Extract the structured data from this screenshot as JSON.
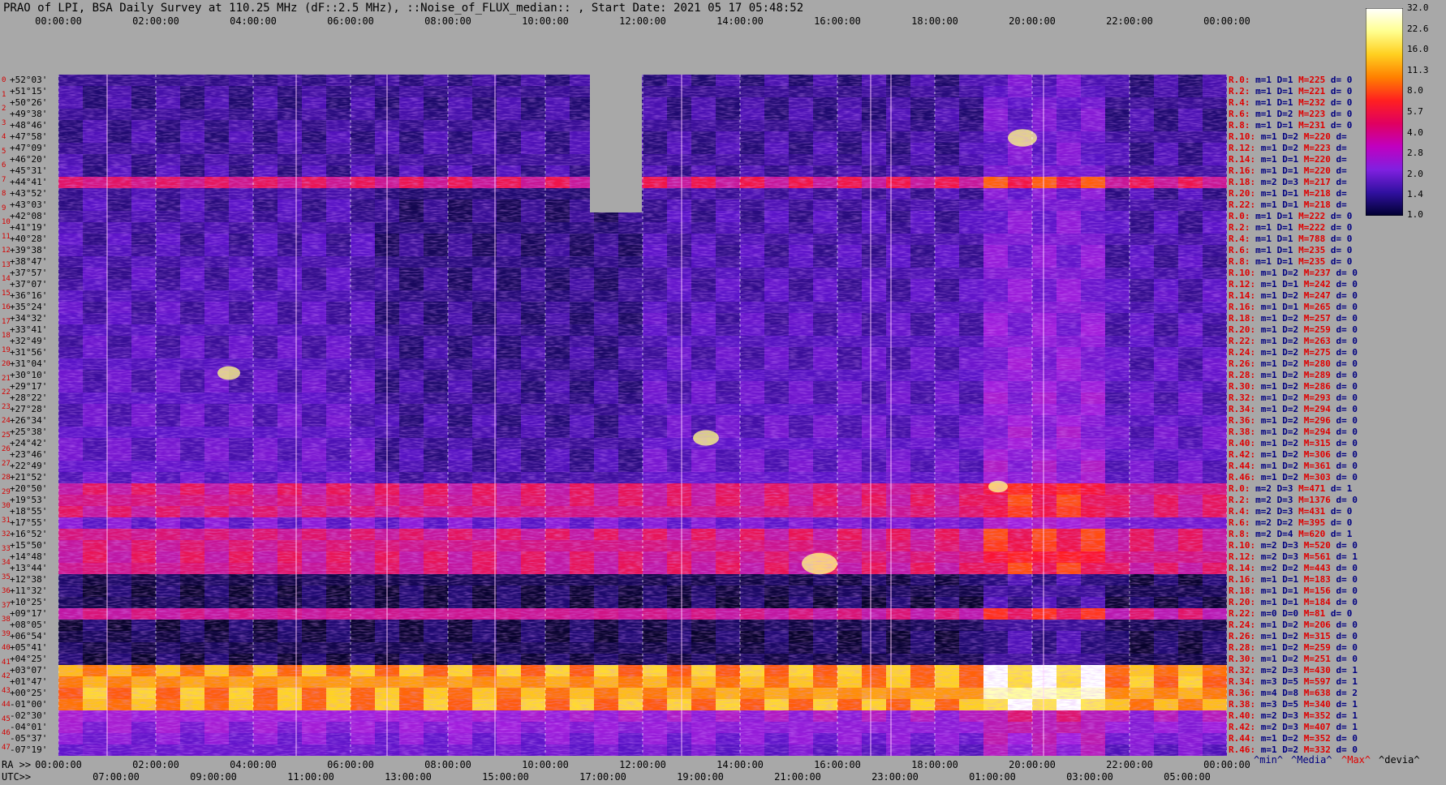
{
  "chart_data": {
    "type": "heatmap",
    "title": "PRAO of LPI, BSA Daily Survey at 110.25 MHz (dF::2.5 MHz), ::Noise_of_FLUX_median:: , Start Date: 2021 05 17 05:48:52",
    "x_top_ticks": [
      "00:00:00",
      "02:00:00",
      "04:00:00",
      "06:00:00",
      "08:00:00",
      "10:00:00",
      "12:00:00",
      "14:00:00",
      "16:00:00",
      "18:00:00",
      "20:00:00",
      "22:00:00",
      "00:00:00"
    ],
    "x_ra_ticks": [
      "00:00:00",
      "02:00:00",
      "04:00:00",
      "06:00:00",
      "08:00:00",
      "10:00:00",
      "12:00:00",
      "14:00:00",
      "16:00:00",
      "18:00:00",
      "20:00:00",
      "22:00:00",
      "00:00:00"
    ],
    "x_utc_ticks": [
      "07:00:00",
      "09:00:00",
      "11:00:00",
      "13:00:00",
      "15:00:00",
      "17:00:00",
      "19:00:00",
      "21:00:00",
      "23:00:00",
      "01:00:00",
      "03:00:00",
      "05:00:00"
    ],
    "ra_prefix": "RA >>",
    "utc_prefix": "UTC>>",
    "declinations": [
      "+52°03'",
      "+51°15'",
      "+50°26'",
      "+49°38'",
      "+48°46'",
      "+47°58'",
      "+47°09'",
      "+46°20'",
      "+45°31'",
      "+44°41'",
      "+43°52'",
      "+43°03'",
      "+42°08'",
      "+41°19'",
      "+40°28'",
      "+39°38'",
      "+38°47'",
      "+37°57'",
      "+37°07'",
      "+36°16'",
      "+35°24'",
      "+34°32'",
      "+33°41'",
      "+32°49'",
      "+31°56'",
      "+31°04'",
      "+30°10'",
      "+29°17'",
      "+28°22'",
      "+27°28'",
      "+26°34'",
      "+25°38'",
      "+24°42'",
      "+23°46'",
      "+22°49'",
      "+21°52'",
      "+20°50'",
      "+19°53'",
      "+18°55'",
      "+17°55'",
      "+16°52'",
      "+15°50'",
      "+14°48'",
      "+13°44'",
      "+12°38'",
      "+11°32'",
      "+10°25'",
      "+09°17'",
      "+08°05'",
      "+06°54'",
      "+05°41'",
      "+04°25'",
      "+03°07'",
      "+01°47'",
      "+00°25'",
      "-01°00'",
      "-02°30'",
      "-04°01'",
      "-05°37'",
      "-07°19'"
    ],
    "row_indices": [
      "0",
      "1",
      "2",
      "3",
      "4",
      "5",
      "6",
      "7",
      "8",
      "9",
      "10",
      "11",
      "12",
      "13",
      "14",
      "15",
      "16",
      "17",
      "18",
      "19",
      "20",
      "21",
      "22",
      "23",
      "24",
      "25",
      "26",
      "27",
      "28",
      "29",
      "30",
      "31",
      "32",
      "33",
      "34",
      "35",
      "36",
      "37",
      "38",
      "39",
      "40",
      "41",
      "42",
      "43",
      "44",
      "45",
      "46",
      "47"
    ],
    "colorbar": {
      "ticks": [
        "32.0",
        "22.6",
        "16.0",
        "11.3",
        "8.0",
        "5.7",
        "4.0",
        "2.8",
        "2.0",
        "1.4",
        "1.0"
      ],
      "colors": [
        "#ffffff",
        "#ffff90",
        "#ffd020",
        "#ff8000",
        "#ff2020",
        "#e00060",
        "#c000c0",
        "#8020e0",
        "#3010a0",
        "#000030"
      ]
    },
    "right_labels": [
      {
        "r": "R.0:",
        "m": "m=1",
        "D": "D=1",
        "M": "M=225",
        "d": "d= 0"
      },
      {
        "r": "R.2:",
        "m": "m=1",
        "D": "D=1",
        "M": "M=221",
        "d": "d= 0"
      },
      {
        "r": "R.4:",
        "m": "m=1",
        "D": "D=1",
        "M": "M=232",
        "d": "d= 0"
      },
      {
        "r": "R.6:",
        "m": "m=1",
        "D": "D=2",
        "M": "M=223",
        "d": "d= 0"
      },
      {
        "r": "R.8:",
        "m": "m=1",
        "D": "D=1",
        "M": "M=231",
        "d": "d= 0"
      },
      {
        "r": "R.10:",
        "m": "m=1",
        "D": "D=2",
        "M": "M=220",
        "d": "d="
      },
      {
        "r": "R.12:",
        "m": "m=1",
        "D": "D=2",
        "M": "M=223",
        "d": "d="
      },
      {
        "r": "R.14:",
        "m": "m=1",
        "D": "D=1",
        "M": "M=220",
        "d": "d="
      },
      {
        "r": "R.16:",
        "m": "m=1",
        "D": "D=1",
        "M": "M=220",
        "d": "d="
      },
      {
        "r": "R.18:",
        "m": "m=2",
        "D": "D=3",
        "M": "M=217",
        "d": "d="
      },
      {
        "r": "R.20:",
        "m": "m=1",
        "D": "D=1",
        "M": "M=218",
        "d": "d="
      },
      {
        "r": "R.22:",
        "m": "m=1",
        "D": "D=1",
        "M": "M=218",
        "d": "d="
      },
      {
        "r": "R.0:",
        "m": "m=1",
        "D": "D=1",
        "M": "M=222",
        "d": "d= 0"
      },
      {
        "r": "R.2:",
        "m": "m=1",
        "D": "D=1",
        "M": "M=222",
        "d": "d= 0"
      },
      {
        "r": "R.4:",
        "m": "m=1",
        "D": "D=1",
        "M": "M=788",
        "d": "d= 0"
      },
      {
        "r": "R.6:",
        "m": "m=1",
        "D": "D=1",
        "M": "M=235",
        "d": "d= 0"
      },
      {
        "r": "R.8:",
        "m": "m=1",
        "D": "D=1",
        "M": "M=235",
        "d": "d= 0"
      },
      {
        "r": "R.10:",
        "m": "m=1",
        "D": "D=2",
        "M": "M=237",
        "d": "d= 0"
      },
      {
        "r": "R.12:",
        "m": "m=1",
        "D": "D=1",
        "M": "M=242",
        "d": "d= 0"
      },
      {
        "r": "R.14:",
        "m": "m=1",
        "D": "D=2",
        "M": "M=247",
        "d": "d= 0"
      },
      {
        "r": "R.16:",
        "m": "m=1",
        "D": "D=1",
        "M": "M=265",
        "d": "d= 0"
      },
      {
        "r": "R.18:",
        "m": "m=1",
        "D": "D=2",
        "M": "M=257",
        "d": "d= 0"
      },
      {
        "r": "R.20:",
        "m": "m=1",
        "D": "D=2",
        "M": "M=259",
        "d": "d= 0"
      },
      {
        "r": "R.22:",
        "m": "m=1",
        "D": "D=2",
        "M": "M=263",
        "d": "d= 0"
      },
      {
        "r": "R.24:",
        "m": "m=1",
        "D": "D=2",
        "M": "M=275",
        "d": "d= 0"
      },
      {
        "r": "R.26:",
        "m": "m=1",
        "D": "D=2",
        "M": "M=280",
        "d": "d= 0"
      },
      {
        "r": "R.28:",
        "m": "m=1",
        "D": "D=2",
        "M": "M=289",
        "d": "d= 0"
      },
      {
        "r": "R.30:",
        "m": "m=1",
        "D": "D=2",
        "M": "M=286",
        "d": "d= 0"
      },
      {
        "r": "R.32:",
        "m": "m=1",
        "D": "D=2",
        "M": "M=293",
        "d": "d= 0"
      },
      {
        "r": "R.34:",
        "m": "m=1",
        "D": "D=2",
        "M": "M=294",
        "d": "d= 0"
      },
      {
        "r": "R.36:",
        "m": "m=1",
        "D": "D=2",
        "M": "M=296",
        "d": "d= 0"
      },
      {
        "r": "R.38:",
        "m": "m=1",
        "D": "D=2",
        "M": "M=294",
        "d": "d= 0"
      },
      {
        "r": "R.40:",
        "m": "m=1",
        "D": "D=2",
        "M": "M=315",
        "d": "d= 0"
      },
      {
        "r": "R.42:",
        "m": "m=1",
        "D": "D=2",
        "M": "M=306",
        "d": "d= 0"
      },
      {
        "r": "R.44:",
        "m": "m=1",
        "D": "D=2",
        "M": "M=361",
        "d": "d= 0"
      },
      {
        "r": "R.46:",
        "m": "m=1",
        "D": "D=2",
        "M": "M=303",
        "d": "d= 0"
      },
      {
        "r": "R.0:",
        "m": "m=2",
        "D": "D=3",
        "M": "M=471",
        "d": "d= 1"
      },
      {
        "r": "R.2:",
        "m": "m=2",
        "D": "D=3",
        "M": "M=1376",
        "d": "d= 0"
      },
      {
        "r": "R.4:",
        "m": "m=2",
        "D": "D=3",
        "M": "M=431",
        "d": "d= 0"
      },
      {
        "r": "R.6:",
        "m": "m=2",
        "D": "D=2",
        "M": "M=395",
        "d": "d= 0"
      },
      {
        "r": "R.8:",
        "m": "m=2",
        "D": "D=4",
        "M": "M=620",
        "d": "d= 1"
      },
      {
        "r": "R.10:",
        "m": "m=2",
        "D": "D=3",
        "M": "M=520",
        "d": "d= 0"
      },
      {
        "r": "R.12:",
        "m": "m=2",
        "D": "D=3",
        "M": "M=561",
        "d": "d= 1"
      },
      {
        "r": "R.14:",
        "m": "m=2",
        "D": "D=2",
        "M": "M=443",
        "d": "d= 0"
      },
      {
        "r": "R.16:",
        "m": "m=1",
        "D": "D=1",
        "M": "M=183",
        "d": "d= 0"
      },
      {
        "r": "R.18:",
        "m": "m=1",
        "D": "D=1",
        "M": "M=156",
        "d": "d= 0"
      },
      {
        "r": "R.20:",
        "m": "m=1",
        "D": "D=1",
        "M": "M=184",
        "d": "d= 0"
      },
      {
        "r": "R.22:",
        "m": "m=0",
        "D": "D=0",
        "M": "M=81",
        "d": "d= 0"
      },
      {
        "r": "R.24:",
        "m": "m=1",
        "D": "D=2",
        "M": "M=206",
        "d": "d= 0"
      },
      {
        "r": "R.26:",
        "m": "m=1",
        "D": "D=2",
        "M": "M=315",
        "d": "d= 0"
      },
      {
        "r": "R.28:",
        "m": "m=1",
        "D": "D=2",
        "M": "M=259",
        "d": "d= 0"
      },
      {
        "r": "R.30:",
        "m": "m=1",
        "D": "D=2",
        "M": "M=251",
        "d": "d= 0"
      },
      {
        "r": "R.32:",
        "m": "m=2",
        "D": "D=3",
        "M": "M=430",
        "d": "d= 1"
      },
      {
        "r": "R.34:",
        "m": "m=3",
        "D": "D=5",
        "M": "M=597",
        "d": "d= 1"
      },
      {
        "r": "R.36:",
        "m": "m=4",
        "D": "D=8",
        "M": "M=638",
        "d": "d= 2"
      },
      {
        "r": "R.38:",
        "m": "m=3",
        "D": "D=5",
        "M": "M=340",
        "d": "d= 1"
      },
      {
        "r": "R.40:",
        "m": "m=2",
        "D": "D=3",
        "M": "M=352",
        "d": "d= 1"
      },
      {
        "r": "R.42:",
        "m": "m=2",
        "D": "D=3",
        "M": "M=407",
        "d": "d= 1"
      },
      {
        "r": "R.44:",
        "m": "m=1",
        "D": "D=2",
        "M": "M=352",
        "d": "d= 0"
      },
      {
        "r": "R.46:",
        "m": "m=1",
        "D": "D=2",
        "M": "M=332",
        "d": "d= 0"
      }
    ],
    "footer_legend": [
      "^min^",
      "^Media^",
      "^Max^",
      "^devia^"
    ]
  }
}
